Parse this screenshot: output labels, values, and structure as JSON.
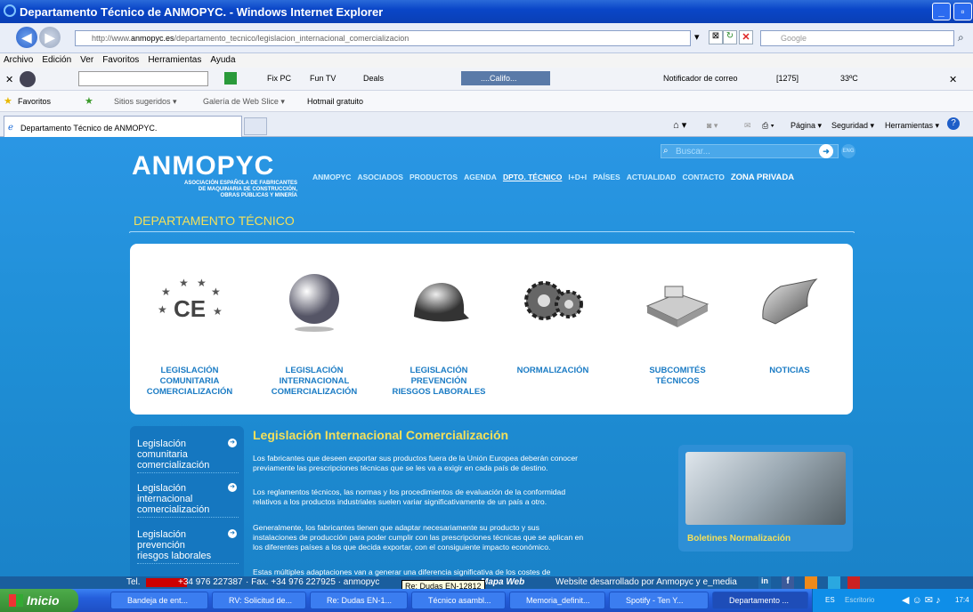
{
  "window": {
    "title": "Departamento Técnico de ANMOPYC. - Windows Internet Explorer"
  },
  "address": {
    "url_prefix": "http://www.",
    "url_domain": "anmopyc.es",
    "url_path": "/departamento_tecnico/legislacion_internacional_comercializacion",
    "search_placeholder": "Google"
  },
  "menu": [
    "Archivo",
    "Edición",
    "Ver",
    "Favoritos",
    "Herramientas",
    "Ayuda"
  ],
  "toolbar": {
    "fixpc": "Fix PC",
    "funtv": "Fun TV",
    "deals": "Deals",
    "weather_loc": "....Califo...",
    "mail_notifier": "Notificador de correo",
    "count": "[1275]",
    "temp": "33ºC"
  },
  "favorites": {
    "label": "Favoritos",
    "items": [
      "Sitios sugeridos ▾",
      "Galería de Web Slice ▾",
      "Hotmail gratuito"
    ]
  },
  "tab": {
    "label": "Departamento Técnico de ANMOPYC."
  },
  "commands": {
    "page": "Página ▾",
    "security": "Seguridad ▾",
    "tools": "Herramientas ▾"
  },
  "site": {
    "logo": "ANMOPYC",
    "logo_sub_1": "ASOCIACIÓN ESPAÑOLA DE FABRICANTES",
    "logo_sub_2": "DE MAQUINARIA DE CONSTRUCCIÓN,",
    "logo_sub_3": "OBRAS PÚBLICAS Y MINERÍA",
    "search_placeholder": "Buscar...",
    "eng": "ENG",
    "nav": [
      "ANMOPYC",
      "ASOCIADOS",
      "PRODUCTOS",
      "AGENDA",
      "DPTO. TÉCNICO",
      "I+D+I",
      "PAÍSES",
      "ACTUALIDAD",
      "CONTACTO",
      "ZONA PRIVADA"
    ],
    "section_title": "DEPARTAMENTO TÉCNICO",
    "categories": [
      {
        "l1": "LEGISLACIÓN",
        "l2": "COMUNITARIA",
        "l3": "COMERCIALIZACIÓN"
      },
      {
        "l1": "LEGISLACIÓN",
        "l2": "INTERNACIONAL",
        "l3": "COMERCIALIZACIÓN"
      },
      {
        "l1": "LEGISLACIÓN",
        "l2": "PREVENCIÓN",
        "l3": "RIESGOS LABORALES"
      },
      {
        "l1": "NORMALIZACIÓN",
        "l2": "",
        "l3": ""
      },
      {
        "l1": "SUBCOMITÉS",
        "l2": "TÉCNICOS",
        "l3": ""
      },
      {
        "l1": "NOTICIAS",
        "l2": "",
        "l3": ""
      }
    ],
    "sidebar": [
      {
        "l1": "Legislación",
        "l2": "comunitaria",
        "l3": "comercialización"
      },
      {
        "l1": "Legislación",
        "l2": "internacional",
        "l3": "comercialización"
      },
      {
        "l1": "Legislación",
        "l2": "prevención",
        "l3": "riesgos laborales"
      }
    ],
    "content_title": "Legislación Internacional Comercialización",
    "paragraphs": [
      {
        "a": "Los fabricantes que deseen exportar sus productos fuera de la Unión Europea deberán conocer",
        "b": "previamente las prescripciones técnicas que se les va a exigir en cada país de destino.",
        "c": ""
      },
      {
        "a": "Los reglamentos técnicos, las normas y los procedimientos de evaluación de la conformidad",
        "b": "relativos a los productos industriales suelen variar significativamente de un país a otro.",
        "c": ""
      },
      {
        "a": "Generalmente, los fabricantes tienen que adaptar necesariamente su producto y sus",
        "b": "instalaciones de producción para poder cumplir con las prescripciones técnicas que se aplican en",
        "c": "los diferentes países a los que decida exportar, con el consiguiente impacto económico."
      },
      {
        "a": "Estas múltiples adaptaciones van a generar una diferencia significativa de los costes de",
        "b": "",
        "c": ""
      }
    ],
    "bulletin": "Boletines Normalización",
    "footer": {
      "tel": "Tel.",
      "phone": "+34 976 227387",
      "fax": "· Fax. +34 976 227925 · anmopyc",
      "mapa": "Mapa Web",
      "dev": "Website desarrollado por Anmopyc y e_media"
    }
  },
  "tooltip": "Re: Dudas EN-12812",
  "taskbar": {
    "start": "Inicio",
    "items": [
      "Bandeja de ent...",
      "RV: Solicitud de...",
      "Re: Dudas EN-1...",
      "Técnico asambl...",
      "Memoria_definit...",
      "Spotify - Ten Y...",
      "Departamento ..."
    ],
    "tray_lang": "ES",
    "tray_desk": "Escritorio",
    "clock": "17:4"
  }
}
